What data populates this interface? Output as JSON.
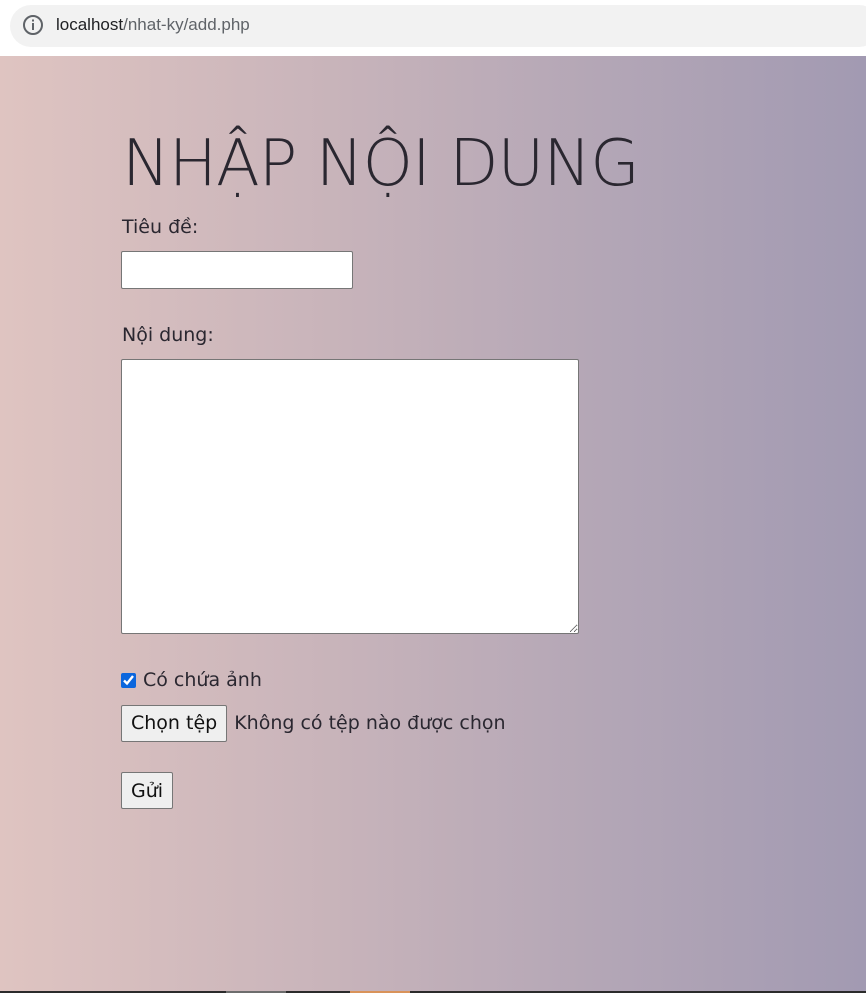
{
  "browser": {
    "url_host": "localhost",
    "url_path": "/nhat-ky/add.php",
    "info_icon": "info-icon"
  },
  "form": {
    "title": "NHẬP NỘI DUNG",
    "title_label": "Tiêu đề:",
    "title_value": "",
    "content_label": "Nội dung:",
    "content_value": "",
    "has_image_label": "Có chứa ảnh",
    "has_image_checked": true,
    "file_button_label": "Chọn tệp",
    "file_status": "Không có tệp nào được chọn",
    "submit_label": "Gửi"
  },
  "colors": {
    "gradient_start": "#dfc4c1",
    "gradient_end": "#a29ab2",
    "checkbox_accent": "#0b66dd"
  }
}
